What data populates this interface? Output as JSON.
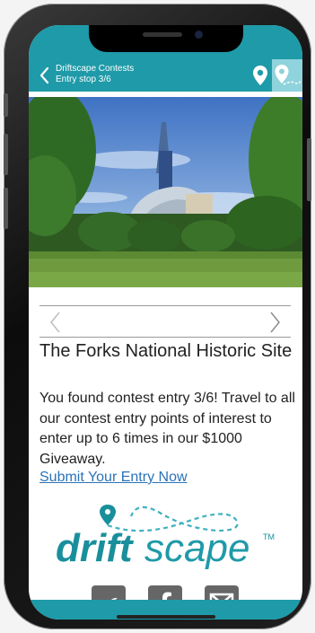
{
  "colors": {
    "accent": "#1f9aa8",
    "link": "#2a73b8",
    "logo_teal": "#1a8f9c"
  },
  "navbar": {
    "title": "Driftscape Contests",
    "subtitle": "Entry stop 3/6",
    "icons": [
      "chevron-left-icon",
      "map-pin-icon",
      "route-pin-icon"
    ]
  },
  "photo": {
    "description_icon": "museum-photo"
  },
  "place": {
    "title": "The Forks National Historic Site",
    "description": "You found contest entry 3/6!  Travel to all our contest entry points of interest to enter up to 6 times in our $1000 Giveaway.",
    "link_label": "Submit Your Entry Now"
  },
  "logo": {
    "text_bold": "drift",
    "text_light": "scape",
    "trademark": "TM"
  },
  "social": [
    "twitter-icon",
    "facebook-icon",
    "email-icon"
  ]
}
